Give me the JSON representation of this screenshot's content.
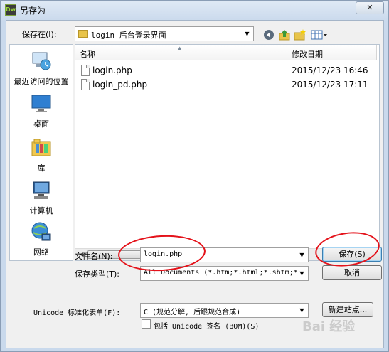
{
  "window": {
    "title": "另存为",
    "app_icon": "Dw",
    "close_label": "✕"
  },
  "save_in": {
    "label": "保存在(I):",
    "value": "login 后台登录界面"
  },
  "toolbar": {
    "icons": [
      "back-icon",
      "up-folder-icon",
      "new-folder-icon",
      "view-menu-icon"
    ]
  },
  "places": [
    {
      "label": "最近访问的位置",
      "icon": "recent-places-icon"
    },
    {
      "label": "桌面",
      "icon": "desktop-icon"
    },
    {
      "label": "库",
      "icon": "libraries-icon"
    },
    {
      "label": "计算机",
      "icon": "computer-icon"
    },
    {
      "label": "网络",
      "icon": "network-icon"
    }
  ],
  "filelist": {
    "columns": [
      "名称",
      "修改日期"
    ],
    "rows": [
      {
        "name": "login.php",
        "date": "2015/12/23 16:46"
      },
      {
        "name": "login_pd.php",
        "date": "2015/12/23 17:11"
      }
    ],
    "scroll_grip": "III"
  },
  "filename": {
    "label": "文件名(N):",
    "value": "login.php"
  },
  "filetype": {
    "label": "保存类型(T):",
    "value": "All Documents (*.htm;*.html;*.shtm;*."
  },
  "buttons": {
    "save": "保存(S)",
    "cancel": "取消",
    "new_site": "新建站点..."
  },
  "unicode": {
    "label": "Unicode 标准化表单(F):",
    "value": "C (规范分解, 后跟规范合成)",
    "bom_label": "包括 Unicode 签名 (BOM)(S)"
  },
  "watermark": "Bai 经验",
  "colors": {
    "annotation": "#e4121a",
    "accent": "#3c7fb1"
  }
}
